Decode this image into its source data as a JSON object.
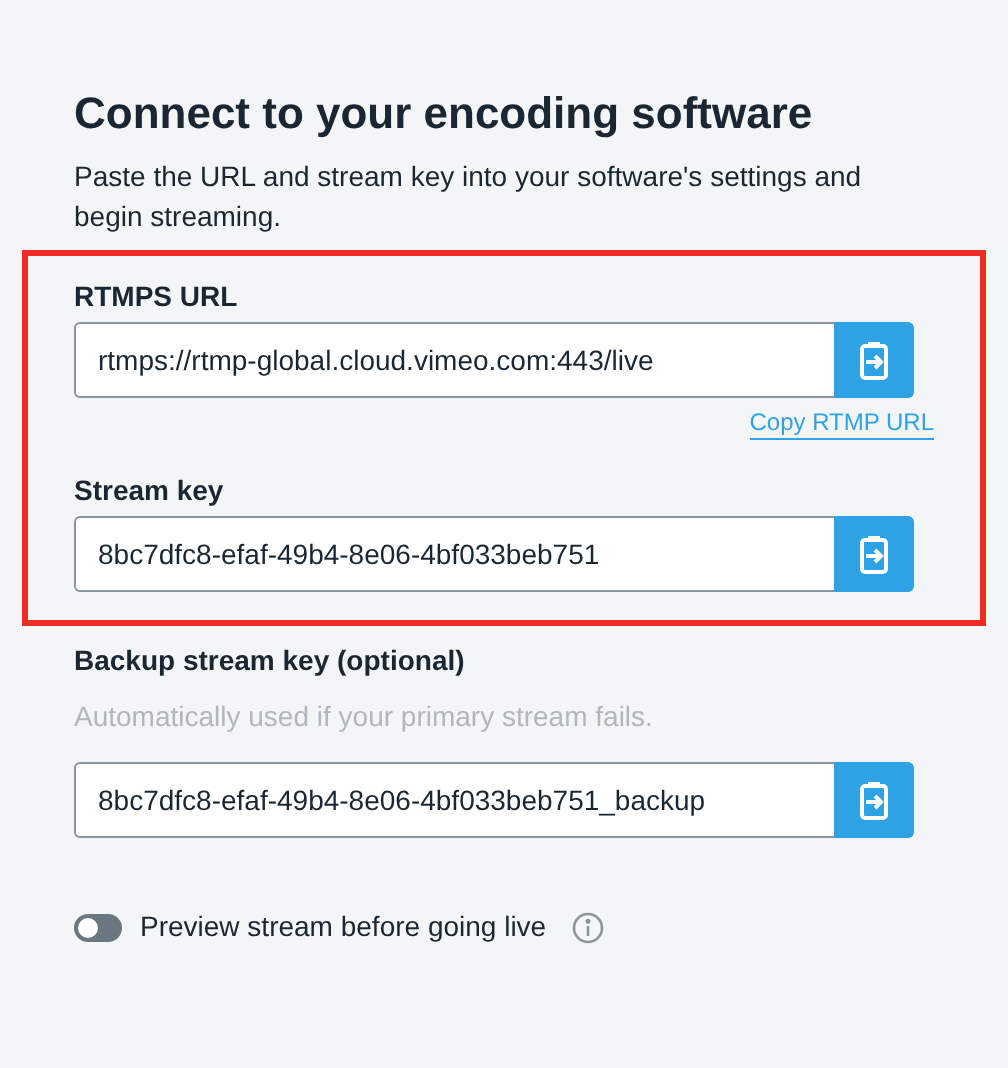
{
  "title": "Connect to your encoding software",
  "description": "Paste the URL and stream key into your software's settings and begin streaming.",
  "fields": [
    {
      "label": "RTMPS URL",
      "value": "rtmps://rtmp-global.cloud.vimeo.com:443/live",
      "highlighted": true,
      "link": "Copy RTMP URL"
    },
    {
      "label": "Stream key",
      "value": "8bc7dfc8-efaf-49b4-8e06-4bf033beb751",
      "highlighted": true
    },
    {
      "label": "Backup stream key (optional)",
      "hint": "Automatically used if your primary stream fails.",
      "value": "8bc7dfc8-efaf-49b4-8e06-4bf033beb751_backup",
      "highlighted": false
    }
  ],
  "preview_toggle": {
    "label": "Preview stream before going live",
    "on": false
  }
}
